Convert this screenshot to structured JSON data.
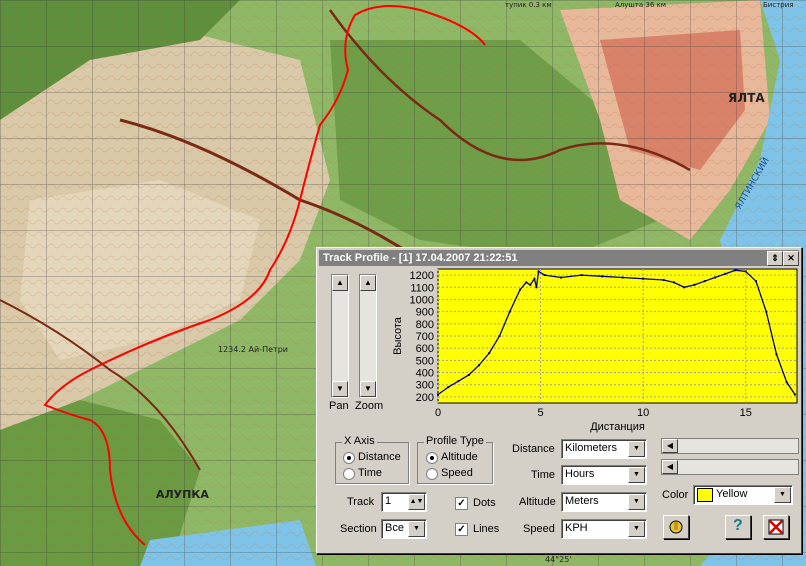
{
  "map": {
    "city_label": "ЯЛТА",
    "town_label": "АЛУПКА",
    "peak_label": "1234.2 Ай-Петри",
    "top_label_1": "тупик 0.3 км",
    "top_label_2": "Алушта 36 км",
    "top_label_3": "Бистрия",
    "sea_label": "ЯЛТИНСКИЙ",
    "lat_label": "44°25'",
    "track_color": "#ff0000"
  },
  "window": {
    "title": "Track Profile - [1] 17.04.2007 21:22:51",
    "pin_icon": "pin-icon",
    "close_icon": "close-icon"
  },
  "sliders": {
    "pan_label": "Pan",
    "zoom_label": "Zoom"
  },
  "xaxis": {
    "group_title": "X Axis",
    "options": [
      "Distance",
      "Time"
    ],
    "selected": "Distance"
  },
  "profile_type": {
    "group_title": "Profile Type",
    "options": [
      "Altitude",
      "Speed"
    ],
    "selected": "Altitude"
  },
  "units": {
    "distance_label": "Distance",
    "distance_value": "Kilometers",
    "time_label": "Time",
    "time_value": "Hours",
    "altitude_label": "Altitude",
    "altitude_value": "Meters",
    "speed_label": "Speed",
    "speed_value": "KPH"
  },
  "track": {
    "label": "Track",
    "value": "1"
  },
  "section": {
    "label": "Section",
    "value": "Все"
  },
  "dots": {
    "label": "Dots",
    "checked": true
  },
  "lines": {
    "label": "Lines",
    "checked": true
  },
  "color": {
    "label": "Color",
    "value": "Yellow",
    "swatch": "#ffff00"
  },
  "chart_data": {
    "type": "line",
    "xlabel": "Дистанция",
    "ylabel": "Высота",
    "xlim": [
      0,
      17.5
    ],
    "ylim": [
      150,
      1250
    ],
    "xticks": [
      0,
      5,
      10,
      15
    ],
    "yticks": [
      200,
      300,
      400,
      500,
      600,
      700,
      800,
      900,
      1000,
      1100,
      1200
    ],
    "background": "#ffff00",
    "line_color": "#000080",
    "grid": true,
    "x": [
      0,
      0.5,
      1.0,
      1.5,
      2.0,
      2.5,
      3.0,
      3.5,
      4.0,
      4.3,
      4.5,
      4.7,
      4.8,
      4.9,
      5.2,
      6.0,
      7.0,
      8.0,
      9.0,
      10.0,
      11.0,
      11.5,
      12.0,
      12.5,
      13.0,
      13.5,
      14.0,
      14.5,
      15.0,
      15.5,
      16.0,
      16.5,
      17.0,
      17.4
    ],
    "y": [
      220,
      280,
      330,
      380,
      460,
      560,
      700,
      900,
      1080,
      1140,
      1120,
      1170,
      1100,
      1230,
      1200,
      1180,
      1200,
      1190,
      1180,
      1170,
      1160,
      1140,
      1100,
      1120,
      1150,
      1180,
      1210,
      1240,
      1230,
      1150,
      900,
      550,
      320,
      220
    ]
  }
}
